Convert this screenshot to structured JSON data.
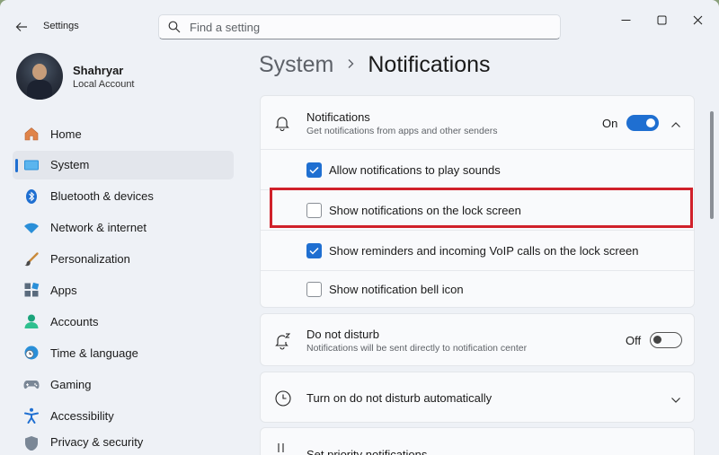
{
  "window": {
    "app_title": "Settings"
  },
  "search": {
    "placeholder": "Find a setting"
  },
  "profile": {
    "name": "Shahryar",
    "account_type": "Local Account"
  },
  "sidebar": {
    "items": [
      {
        "label": "Home",
        "icon": "home-icon"
      },
      {
        "label": "System",
        "icon": "system-icon",
        "active": true
      },
      {
        "label": "Bluetooth & devices",
        "icon": "bluetooth-icon"
      },
      {
        "label": "Network & internet",
        "icon": "wifi-icon"
      },
      {
        "label": "Personalization",
        "icon": "brush-icon"
      },
      {
        "label": "Apps",
        "icon": "apps-icon"
      },
      {
        "label": "Accounts",
        "icon": "accounts-icon"
      },
      {
        "label": "Time & language",
        "icon": "globe-clock-icon"
      },
      {
        "label": "Gaming",
        "icon": "gamepad-icon"
      },
      {
        "label": "Accessibility",
        "icon": "accessibility-icon"
      },
      {
        "label": "Privacy & security",
        "icon": "shield-icon"
      }
    ]
  },
  "breadcrumb": {
    "parent": "System",
    "current": "Notifications"
  },
  "notifications": {
    "title": "Notifications",
    "subtitle": "Get notifications from apps and other senders",
    "toggle_label": "On",
    "toggle_on": true,
    "options": [
      {
        "label": "Allow notifications to play sounds",
        "checked": true
      },
      {
        "label": "Show notifications on the lock screen",
        "checked": false
      },
      {
        "label": "Show reminders and incoming VoIP calls on the lock screen",
        "checked": true
      },
      {
        "label": "Show notification bell icon",
        "checked": false
      }
    ]
  },
  "do_not_disturb": {
    "title": "Do not disturb",
    "subtitle": "Notifications will be sent directly to notification center",
    "toggle_label": "Off",
    "toggle_on": false
  },
  "dnd_auto": {
    "title": "Turn on do not disturb automatically"
  },
  "set_priority": {
    "title": "Set priority notifications"
  },
  "colors": {
    "accent": "#1f6fd1",
    "highlight": "#d0202a"
  }
}
